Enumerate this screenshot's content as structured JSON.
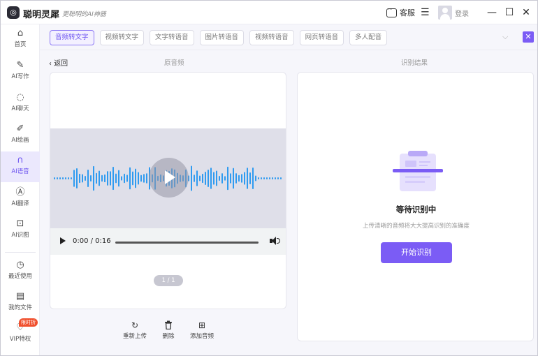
{
  "app": {
    "name": "聪明灵犀",
    "slogan": "更聪明的AI神器",
    "logo_icon": "logo-icon"
  },
  "titlebar": {
    "service_label": "客服",
    "login_label": "登录"
  },
  "sidebar": {
    "items": [
      {
        "label": "首页",
        "icon": "home-icon",
        "glyph": "⌂",
        "active": false
      },
      {
        "label": "AI写作",
        "icon": "pen-icon",
        "glyph": "✎",
        "active": false
      },
      {
        "label": "AI聊天",
        "icon": "chat-icon",
        "glyph": "◌",
        "active": false
      },
      {
        "label": "AI绘画",
        "icon": "brush-icon",
        "glyph": "✐",
        "active": false
      },
      {
        "label": "AI语音",
        "icon": "headphones-icon",
        "glyph": "∩",
        "active": true
      },
      {
        "label": "AI翻译",
        "icon": "translate-icon",
        "glyph": "Ⓐ",
        "active": false
      },
      {
        "label": "AI识图",
        "icon": "scan-icon",
        "glyph": "⊡",
        "active": false
      },
      {
        "label": "最近使用",
        "icon": "history-icon",
        "glyph": "◷",
        "active": false
      },
      {
        "label": "我的文件",
        "icon": "file-icon",
        "glyph": "▤",
        "active": false
      },
      {
        "label": "VIP特权",
        "icon": "vip-icon",
        "glyph": "♡",
        "active": false
      }
    ],
    "vip_badge": "限时折"
  },
  "tabs": [
    {
      "label": "音频转文字",
      "active": true
    },
    {
      "label": "视频转文字",
      "active": false
    },
    {
      "label": "文字转语音",
      "active": false
    },
    {
      "label": "图片转语音",
      "active": false
    },
    {
      "label": "视频转语音",
      "active": false
    },
    {
      "label": "网页转语音",
      "active": false
    },
    {
      "label": "多人配音",
      "active": false
    }
  ],
  "panel": {
    "back_label": "返回",
    "source_heading": "原音频",
    "result_heading": "识别结果"
  },
  "player": {
    "current_time": "0:00",
    "duration": "0:16",
    "time_text": "0:00 / 0:16",
    "progress": 0
  },
  "pager": "1 / 1",
  "actions": [
    {
      "label": "重新上传",
      "icon": "refresh-icon",
      "glyph": "↻"
    },
    {
      "label": "删除",
      "icon": "trash-icon",
      "glyph": "🗑"
    },
    {
      "label": "添加音频",
      "icon": "add-audio-icon",
      "glyph": "⊞"
    }
  ],
  "result": {
    "status_title": "等待识别中",
    "tip": "上传清晰的音频将大大提高识别的准确度",
    "start_button": "开始识别"
  },
  "colors": {
    "accent": "#7b5cf5",
    "wave": "#2f9bf0",
    "active_bg": "#ebe8fd"
  }
}
